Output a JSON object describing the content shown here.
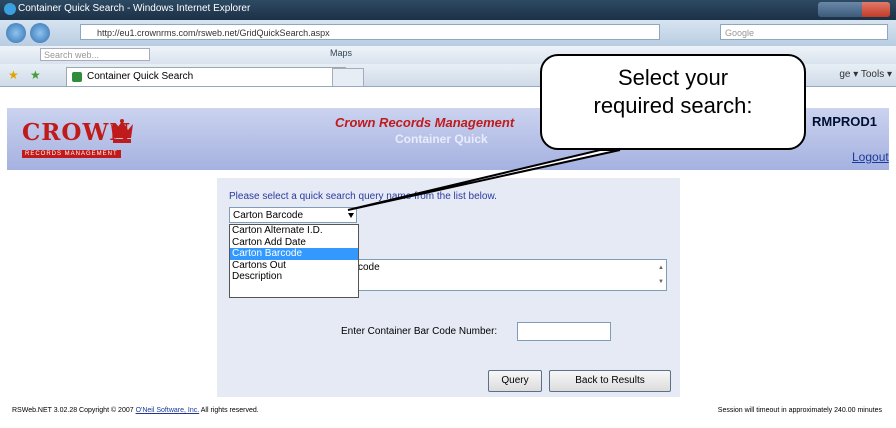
{
  "window": {
    "title": "Container Quick Search - Windows Internet Explorer"
  },
  "addressbar": {
    "url": "http://eu1.crownrms.com/rsweb.net/GridQuickSearch.aspx",
    "search_placeholder": "Google"
  },
  "toolbar": {
    "websearch_placeholder": "Search web...",
    "maps_label": "Maps"
  },
  "tabs": {
    "active_label": "Container Quick Search",
    "right_label": "ge ▾  Tools ▾"
  },
  "header": {
    "logo_text": "CROWN",
    "logo_subtext": "RECORDS MANAGEMENT",
    "app_title": "Crown Records Management",
    "page_title": "Container Quick",
    "database": "RMPROD1",
    "logout": "Logout"
  },
  "form": {
    "instruction": "Please select a quick search query name from the list below.",
    "selected_query": "Carton Barcode",
    "options": [
      "Carton Alternate I.D.",
      "Carton Add Date",
      "Carton Barcode",
      "Cartons Out",
      "Description"
    ],
    "description_text": "code",
    "field_label": "Enter Container Bar Code Number:",
    "query_button": "Query",
    "back_button": "Back to Results"
  },
  "footer": {
    "copyright_prefix": "RSWeb.NET 3.02.28 Copyright © 2007 ",
    "company": "O'Neil Software, Inc.",
    "copyright_suffix": " All rights reserved.",
    "session": "Session will timeout in approximately 240.00 minutes"
  },
  "callout": {
    "line1": "Select your",
    "line2": "required search:"
  },
  "colors": {
    "brand_red": "#c01b1b",
    "header_bg": "#a5b1e0",
    "panel_bg": "#e6eaf5",
    "selection": "#3399ff"
  }
}
